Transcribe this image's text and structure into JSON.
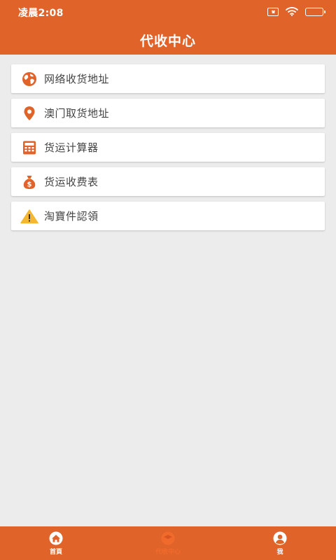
{
  "status_bar": {
    "time": "凌晨2:08",
    "battery": "100",
    "battery_level": 1.0
  },
  "header": {
    "title": "代收中心"
  },
  "menu": {
    "items": [
      {
        "label": "网络收货地址",
        "icon": "globe-icon"
      },
      {
        "label": "澳门取货地址",
        "icon": "location-pin-icon"
      },
      {
        "label": "货运计算器",
        "icon": "calculator-icon"
      },
      {
        "label": "货运收费表",
        "icon": "money-bag-icon"
      },
      {
        "label": "淘寶件認領",
        "icon": "warning-icon"
      }
    ]
  },
  "bottom_nav": {
    "items": [
      {
        "label": "首頁",
        "icon": "home-icon",
        "active": false
      },
      {
        "label": "代收中心",
        "icon": "package-icon",
        "active": true
      },
      {
        "label": "我",
        "icon": "user-icon",
        "active": false
      }
    ]
  },
  "colors": {
    "primary": "#e0632a",
    "background": "#ececec",
    "warning": "#f5b731"
  }
}
